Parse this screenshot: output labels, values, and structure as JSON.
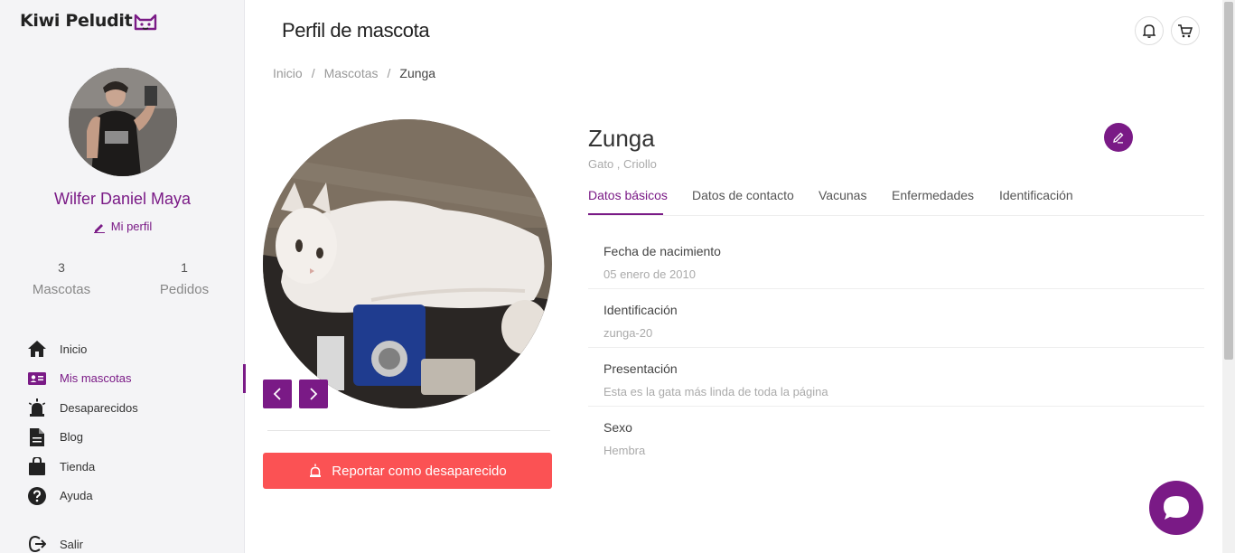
{
  "brand": {
    "name": "Kiwi Peludit"
  },
  "user": {
    "name": "Wilfer Daniel Maya",
    "profile_link": "Mi perfil"
  },
  "stats": [
    {
      "value": "3",
      "label": "Mascotas"
    },
    {
      "value": "1",
      "label": "Pedidos"
    }
  ],
  "nav": [
    {
      "label": "Inicio",
      "icon": "home-icon"
    },
    {
      "label": "Mis mascotas",
      "icon": "id-card-icon",
      "active": true
    },
    {
      "label": "Desaparecidos",
      "icon": "alarm-icon"
    },
    {
      "label": "Blog",
      "icon": "document-icon"
    },
    {
      "label": "Tienda",
      "icon": "shopping-bag-icon"
    },
    {
      "label": "Ayuda",
      "icon": "help-icon"
    }
  ],
  "exit": {
    "label": "Salir"
  },
  "header": {
    "title": "Perfil de mascota"
  },
  "breadcrumb": [
    "Inicio",
    "Mascotas",
    "Zunga"
  ],
  "pet": {
    "name": "Zunga",
    "subtitle": "Gato , Criollo"
  },
  "tabs": [
    "Datos básicos",
    "Datos de contacto",
    "Vacunas",
    "Enfermedades",
    "Identificación"
  ],
  "fields": [
    {
      "label": "Fecha de nacimiento",
      "value": "05 enero de 2010"
    },
    {
      "label": "Identificación",
      "value": "zunga-20"
    },
    {
      "label": "Presentación",
      "value": "Esta es la gata más linda de toda la página"
    },
    {
      "label": "Sexo",
      "value": "Hembra"
    }
  ],
  "actions": {
    "report": "Reportar como desaparecido"
  },
  "colors": {
    "accent": "#7a1a86",
    "danger": "#fb5254"
  }
}
